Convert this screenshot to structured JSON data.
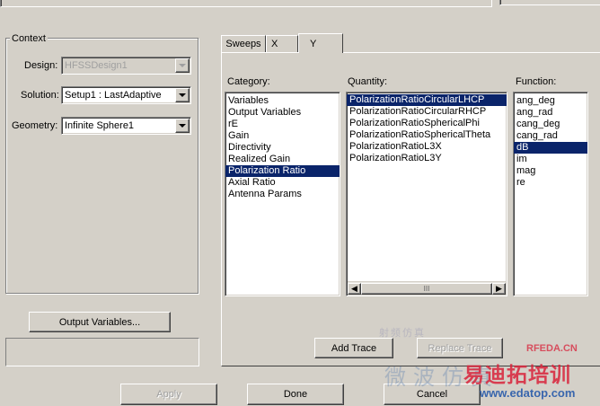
{
  "context": {
    "title": "Context",
    "design_label": "Design:",
    "design_value": "HFSSDesign1",
    "solution_label": "Solution:",
    "solution_value": "Setup1 : LastAdaptive",
    "geometry_label": "Geometry:",
    "geometry_value": "Infinite Sphere1"
  },
  "buttons": {
    "output_variables": "Output Variables...",
    "add_trace": "Add Trace",
    "replace_trace": "Replace Trace",
    "apply": "Apply",
    "done": "Done",
    "cancel": "Cancel"
  },
  "tabs": [
    "Sweeps",
    "X",
    "Y"
  ],
  "active_tab": "Y",
  "category": {
    "label": "Category:",
    "items": [
      "Variables",
      "Output Variables",
      "rE",
      "Gain",
      "Directivity",
      "Realized Gain",
      "Polarization Ratio",
      "Axial Ratio",
      "Antenna Params"
    ],
    "selected": "Polarization Ratio"
  },
  "quantity": {
    "label": "Quantity:",
    "items": [
      "PolarizationRatioCircularLHCP",
      "PolarizationRatioCircularRHCP",
      "PolarizationRatioSphericalPhi",
      "PolarizationRatioSphericalTheta",
      "PolarizationRatioL3X",
      "PolarizationRatioL3Y"
    ],
    "selected": "PolarizationRatioCircularLHCP",
    "scroll_thumb_glyph": "III"
  },
  "function": {
    "label": "Function:",
    "items": [
      "ang_deg",
      "ang_rad",
      "cang_deg",
      "cang_rad",
      "dB",
      "im",
      "mag",
      "re"
    ],
    "selected": "dB"
  },
  "watermark": {
    "brand": "RFEDA.CN",
    "chinese_1": "射频仿真",
    "chinese_2": "微波仿真",
    "chinese_3": "易迪拓培训",
    "url": "www.edatop.com"
  },
  "colors": {
    "face": "#d4d0c8",
    "selection": "#0a246a",
    "watermark_red": "#d8223a",
    "watermark_blue": "#5a7fb0"
  },
  "icons": [
    "chevron-down-icon",
    "scroll-left-icon",
    "scroll-right-icon"
  ]
}
